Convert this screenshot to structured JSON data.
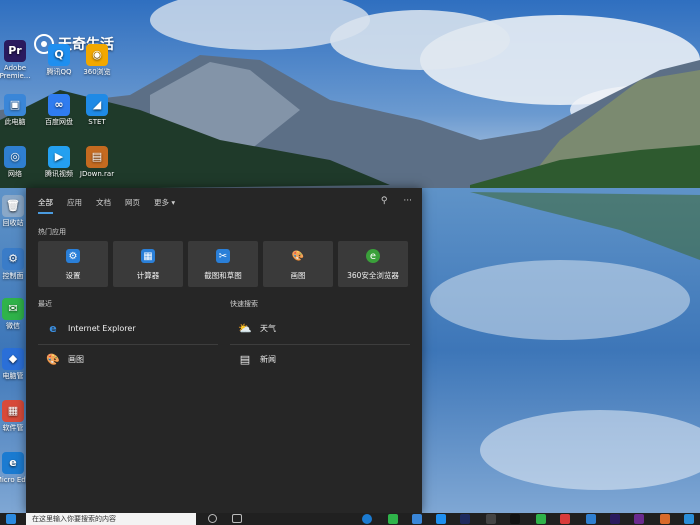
{
  "watermark": {
    "text": "天奇生活"
  },
  "desktop_icons": [
    {
      "label": "Adobe Premie...",
      "glyph": "Pr",
      "color": "#2a1a5e"
    },
    {
      "label": "此电脑",
      "glyph": "▣",
      "color": "#3a86d8"
    },
    {
      "label": "网络",
      "glyph": "◎",
      "color": "#2f7fd0"
    },
    {
      "label": "回收站",
      "glyph": "🗑",
      "color": "#8aa8c8"
    },
    {
      "label": "控制面",
      "glyph": "⚙",
      "color": "#3a7cc8"
    },
    {
      "label": "微信",
      "glyph": "✉",
      "color": "#2fb34a"
    },
    {
      "label": "电脑管",
      "glyph": "◆",
      "color": "#2a6fd8"
    },
    {
      "label": "软件管",
      "glyph": "▦",
      "color": "#d84a3a"
    },
    {
      "label": "Micro Edg",
      "glyph": "e",
      "color": "#1b7bd1"
    }
  ],
  "desktop_icons_col2": [
    {
      "label": "腾讯QQ",
      "glyph": "Q",
      "color": "#1e8ff0"
    },
    {
      "label": "百度网盘",
      "glyph": "∞",
      "color": "#2f7cf0"
    },
    {
      "label": "腾讯视频",
      "glyph": "▶",
      "color": "#24a0f0"
    }
  ],
  "desktop_icons_col3": [
    {
      "label": "360浏览",
      "glyph": "◉",
      "color": "#f2a800"
    },
    {
      "label": "STET",
      "glyph": "◢",
      "color": "#1f8ae6"
    },
    {
      "label": "JDown.rar",
      "glyph": "▤",
      "color": "#c46a20"
    }
  ],
  "panel": {
    "tabs": [
      "全部",
      "应用",
      "文档",
      "网页",
      "更多 ▾"
    ],
    "active_tab": 0,
    "tools": {
      "pin_icon": "⚲",
      "more_icon": "···"
    },
    "top_apps_title": "热门应用",
    "top_apps": [
      {
        "label": "设置",
        "glyph": "⚙",
        "color": "#2a7fd8"
      },
      {
        "label": "计算器",
        "glyph": "▦",
        "color": "#2a7fd8"
      },
      {
        "label": "截图和草图",
        "glyph": "✂",
        "color": "#2a7fd8"
      },
      {
        "label": "画图",
        "glyph": "🎨",
        "color": "#3a3a3a"
      },
      {
        "label": "360安全浏览器",
        "glyph": "e",
        "color": "#3aa03a"
      }
    ],
    "recent_title": "最近",
    "recent": [
      {
        "label": "Internet Explorer",
        "glyph": "e",
        "color": "#3b8fe0"
      },
      {
        "label": "画图",
        "glyph": "🎨",
        "color": "#cccccc"
      }
    ],
    "quick_title": "快速搜索",
    "quick": [
      {
        "label": "天气",
        "glyph": "⛅"
      },
      {
        "label": "新闻",
        "glyph": "▤"
      }
    ]
  },
  "taskbar": {
    "search_placeholder": "在这里输入你要搜索的内容"
  }
}
